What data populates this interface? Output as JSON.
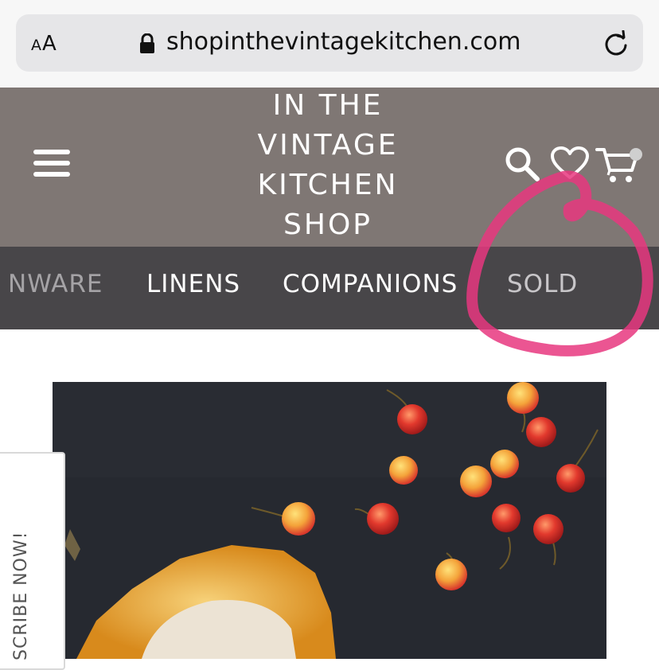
{
  "browser": {
    "aa_label_small": "A",
    "aa_label_large": "A",
    "url": "shopinthevintagekitchen.com",
    "icons": [
      "lock-icon",
      "reload-icon"
    ]
  },
  "header": {
    "logo_lines": [
      "IN THE",
      "VINTAGE",
      "KITCHEN",
      "SHOP"
    ],
    "icons": [
      "hamburger-menu-icon",
      "search-icon",
      "heart-icon",
      "cart-icon"
    ],
    "background_color": "#7f7774"
  },
  "category_nav": {
    "items": [
      {
        "label": "NWARE"
      },
      {
        "label": "LINENS"
      },
      {
        "label": "COMPANIONS"
      },
      {
        "label": "SOLD"
      }
    ],
    "background_color": "#484649"
  },
  "subscribe_tab": {
    "label": "SCRIBE NOW!"
  },
  "annotation": {
    "color": "#e8377f",
    "description_target": "SOLD"
  }
}
